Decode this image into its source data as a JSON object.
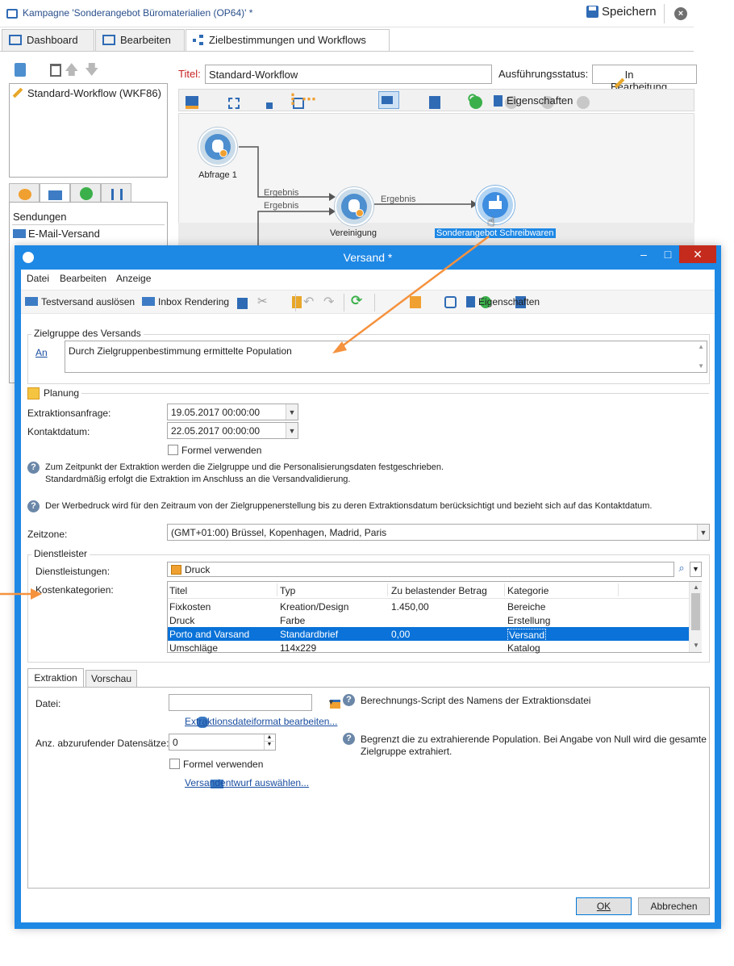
{
  "window": {
    "title": "Kampagne 'Sonderangebot Büromaterialien (OP64)' *",
    "save_label": "Speichern",
    "tabs": [
      {
        "label": "Dashboard"
      },
      {
        "label": "Bearbeiten"
      },
      {
        "label": "Zielbestimmungen und Workflows"
      }
    ]
  },
  "workflow_list": {
    "items": [
      "Standard-Workflow (WKF86)"
    ]
  },
  "left_panel": {
    "heading": "Sendungen",
    "items": [
      "E-Mail-Versand"
    ]
  },
  "workflow_form": {
    "title_label": "Titel:",
    "title_value": "Standard-Workflow",
    "status_label": "Ausführungsstatus:",
    "status_value": "In Bearbeitung",
    "properties_label": "Eigenschaften"
  },
  "canvas": {
    "nodes": [
      {
        "label": "Abfrage 1"
      },
      {
        "label": "Vereinigung"
      },
      {
        "label": "Sonderangebot Schreibwaren"
      }
    ],
    "edges": [
      "Ergebnis",
      "Ergebnis",
      "Ergebnis"
    ]
  },
  "dialog": {
    "title": "Versand *",
    "menu": [
      "Datei",
      "Bearbeiten",
      "Anzeige"
    ],
    "toolbar": {
      "proof_label": "Testversand auslösen",
      "inbox_label": "Inbox Rendering",
      "properties_label": "Eigenschaften"
    },
    "target": {
      "group_title": "Zielgruppe des Versands",
      "to_link": "An",
      "to_value": "Durch Zielgruppenbestimmung ermittelte Population"
    },
    "planning": {
      "title": "Planung",
      "extraction_label": "Extraktionsanfrage:",
      "extraction_value": "19.05.2017 00:00:00",
      "contact_label": "Kontaktdatum:",
      "contact_value": "22.05.2017 00:00:00",
      "formula_label": "Formel verwenden",
      "help1_line1": "Zum Zeitpunkt der Extraktion werden die Zielgruppe und die Personalisierungsdaten festgeschrieben.",
      "help1_line2": "Standardmäßig erfolgt die Extraktion im Anschluss an die Versandvalidierung.",
      "help2": "Der Werbedruck wird für den Zeitraum von der Zielgruppenerstellung bis zu deren Extraktionsdatum berücksichtigt und bezieht sich auf das Kontaktdatum.",
      "timezone_label": "Zeitzone:",
      "timezone_value": "(GMT+01:00) Brüssel, Kopenhagen, Madrid, Paris"
    },
    "provider": {
      "title": "Dienstleister",
      "services_label": "Dienstleistungen:",
      "services_value": "Druck",
      "costs_label": "Kostenkategorien:",
      "columns": [
        "Titel",
        "Typ",
        "Zu belastender Betrag",
        "Kategorie"
      ],
      "rows": [
        {
          "titel": "Fixkosten",
          "typ": "Kreation/Design",
          "betrag": "1.450,00",
          "kategorie": "Bereiche"
        },
        {
          "titel": "Druck",
          "typ": "Farbe",
          "betrag": "",
          "kategorie": "Erstellung"
        },
        {
          "titel": "Porto and Varsand",
          "typ": "Standardbrief",
          "betrag": "0,00",
          "kategorie": "Versand"
        },
        {
          "titel": "Umschläge",
          "typ": "114x229",
          "betrag": "",
          "kategorie": "Katalog"
        }
      ],
      "selected_row": 2
    },
    "tabs": [
      "Extraktion",
      "Vorschau"
    ],
    "extraction": {
      "file_label": "Datei:",
      "file_value": "",
      "file_help": "Berechnungs-Script des Namens der Extraktionsdatei",
      "format_link": "Extraktionsdateiformat bearbeiten...",
      "count_label": "Anz. abzurufender Datensätze:",
      "count_value": "0",
      "count_help_line1": "Begrenzt die zu extrahierende Population. Bei Angabe von Null wird die gesamte",
      "count_help_line2": "Zielgruppe extrahiert.",
      "formula_label": "Formel verwenden",
      "template_link": "Versandentwurf auswählen..."
    },
    "buttons": {
      "ok": "OK",
      "cancel": "Abbrechen"
    }
  },
  "colors": {
    "accent": "#1e88e5",
    "selection": "#0a72d8",
    "arrow": "#f5923e",
    "required": "#c82020"
  }
}
